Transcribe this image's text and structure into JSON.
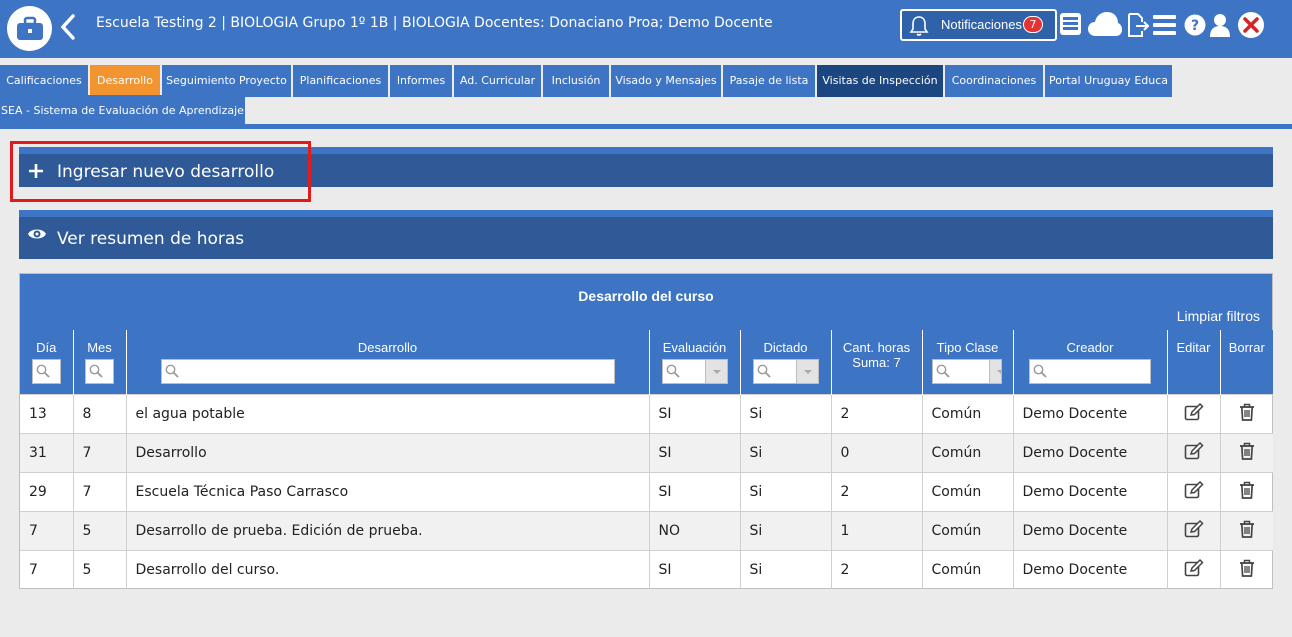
{
  "header": {
    "title": "Escuela Testing 2 | BIOLOGIA Grupo 1º 1B | BIOLOGIA Docentes: Donaciano Proa; Demo Docente",
    "notifications_label": "Notificaciones",
    "notifications_count": "7",
    "icons": [
      "briefcase-icon",
      "back-icon",
      "bell-icon",
      "list-card-icon",
      "cloud-icon",
      "export-icon",
      "menu-icon",
      "help-icon",
      "user-icon",
      "close-icon"
    ]
  },
  "tabs": [
    {
      "label": "Calificaciones",
      "state": "normal"
    },
    {
      "label": "Desarrollo",
      "state": "active"
    },
    {
      "label": "Seguimiento Proyecto",
      "state": "normal"
    },
    {
      "label": "Planificaciones",
      "state": "normal"
    },
    {
      "label": "Informes",
      "state": "normal"
    },
    {
      "label": "Ad. Curricular",
      "state": "normal"
    },
    {
      "label": "Inclusión",
      "state": "normal"
    },
    {
      "label": "Visado y Mensajes",
      "state": "normal"
    },
    {
      "label": "Pasaje de lista",
      "state": "normal"
    },
    {
      "label": "Visitas de Inspección",
      "state": "dark"
    },
    {
      "label": "Coordinaciones",
      "state": "normal"
    },
    {
      "label": "Portal Uruguay Educa",
      "state": "normal"
    },
    {
      "label": "SEA - Sistema de Evaluación de Aprendizaje",
      "state": "normal"
    }
  ],
  "accordions": {
    "new": {
      "label": "Ingresar nuevo desarrollo",
      "icon": "plus-icon"
    },
    "summary": {
      "label": "Ver resumen de horas",
      "icon": "eye-icon"
    }
  },
  "panel": {
    "title": "Desarrollo del curso",
    "clear_filters": "Limpiar filtros",
    "columns": {
      "dia": "Día",
      "mes": "Mes",
      "desarrollo": "Desarrollo",
      "evaluacion": "Evaluación",
      "dictado": "Dictado",
      "cant_horas": "Cant. horas",
      "suma": "Suma: 7",
      "tipo": "Tipo Clase",
      "creador": "Creador",
      "editar": "Editar",
      "borrar": "Borrar"
    },
    "rows": [
      {
        "dia": "13",
        "mes": "8",
        "desarrollo": "el agua potable",
        "evaluacion": "SI",
        "dictado": "Si",
        "horas": "2",
        "tipo": "Común",
        "creador": "Demo Docente"
      },
      {
        "dia": "31",
        "mes": "7",
        "desarrollo": "Desarrollo",
        "evaluacion": "SI",
        "dictado": "Si",
        "horas": "0",
        "tipo": "Común",
        "creador": "Demo Docente"
      },
      {
        "dia": "29",
        "mes": "7",
        "desarrollo": "Escuela Técnica Paso Carrasco",
        "evaluacion": "SI",
        "dictado": "Si",
        "horas": "2",
        "tipo": "Común",
        "creador": "Demo Docente"
      },
      {
        "dia": "7",
        "mes": "5",
        "desarrollo": "Desarrollo de prueba. Edición de prueba.",
        "evaluacion": "NO",
        "dictado": "Si",
        "horas": "1",
        "tipo": "Común",
        "creador": "Demo Docente"
      },
      {
        "dia": "7",
        "mes": "5",
        "desarrollo": "Desarrollo del curso.",
        "evaluacion": "SI",
        "dictado": "Si",
        "horas": "2",
        "tipo": "Común",
        "creador": "Demo Docente"
      }
    ]
  },
  "colors": {
    "primary": "#3d74c4",
    "dark": "#2f5a97",
    "active_tab": "#f2942f",
    "highlight": "#e11b1b"
  }
}
